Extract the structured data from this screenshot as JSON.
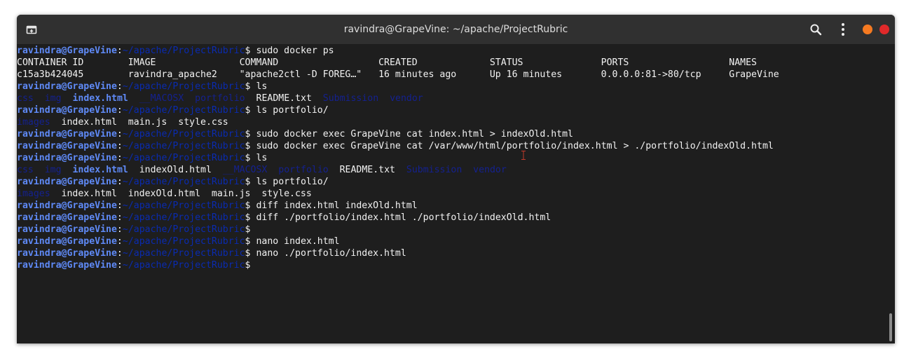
{
  "window": {
    "title": "ravindra@GrapeVine: ~/apache/ProjectRubric"
  },
  "icons": {
    "new_tab": "new-tab-icon",
    "search": "search-icon",
    "menu": "kebab-menu-icon",
    "minimize": "minimize-icon",
    "close": "close-icon"
  },
  "colors": {
    "background": "#1e1e1e",
    "titlebar": "#303030",
    "prompt_user": "#5f8af7",
    "prompt_path": "#0a2bb0",
    "directory": "#14218f",
    "text": "#f2f2f2",
    "minimize": "#f57a21",
    "close": "#e0292a"
  },
  "prompt": {
    "user": "ravindra@GrapeVine",
    "sep": ":",
    "path": "~/apache/ProjectRubric",
    "dollar": "$"
  },
  "lines": [
    {
      "type": "prompt",
      "cmd": " sudo docker ps"
    },
    {
      "type": "output",
      "segments": [
        {
          "k": "f",
          "t": "CONTAINER ID        IMAGE               COMMAND                  CREATED             STATUS              PORTS                  NAMES"
        }
      ]
    },
    {
      "type": "output",
      "segments": [
        {
          "k": "f",
          "t": "c15a3b424045        ravindra_apache2    \"apache2ctl -D FOREG…\"   16 minutes ago      Up 16 minutes       0.0.0.0:81->80/tcp     GrapeVine"
        }
      ]
    },
    {
      "type": "prompt",
      "cmd": " ls"
    },
    {
      "type": "output",
      "segments": [
        {
          "k": "d",
          "t": "css"
        },
        {
          "k": "f",
          "t": "  "
        },
        {
          "k": "d",
          "t": "img"
        },
        {
          "k": "f",
          "t": "  "
        },
        {
          "k": "u",
          "t": "index.html"
        },
        {
          "k": "f",
          "t": "  "
        },
        {
          "k": "d",
          "t": "__MACOSX"
        },
        {
          "k": "f",
          "t": "  "
        },
        {
          "k": "d",
          "t": "portfolio"
        },
        {
          "k": "f",
          "t": "  README.txt  "
        },
        {
          "k": "d",
          "t": "Submission"
        },
        {
          "k": "f",
          "t": "  "
        },
        {
          "k": "d",
          "t": "vendor"
        }
      ]
    },
    {
      "type": "prompt",
      "cmd": " ls portfolio/"
    },
    {
      "type": "output",
      "segments": [
        {
          "k": "d",
          "t": "images"
        },
        {
          "k": "f",
          "t": "  index.html  main.js  style.css"
        }
      ]
    },
    {
      "type": "prompt",
      "cmd": " sudo docker exec GrapeVine cat index.html > indexOld.html"
    },
    {
      "type": "prompt",
      "cmd": " sudo docker exec GrapeVine cat /var/www/html/portfolio/index.html > ./portfolio/indexOld.html"
    },
    {
      "type": "prompt",
      "cmd": " ls"
    },
    {
      "type": "output",
      "segments": [
        {
          "k": "d",
          "t": "css"
        },
        {
          "k": "f",
          "t": "  "
        },
        {
          "k": "d",
          "t": "img"
        },
        {
          "k": "f",
          "t": "  "
        },
        {
          "k": "u",
          "t": "index.html"
        },
        {
          "k": "f",
          "t": "  indexOld.html  "
        },
        {
          "k": "d",
          "t": "__MACOSX"
        },
        {
          "k": "f",
          "t": "  "
        },
        {
          "k": "d",
          "t": "portfolio"
        },
        {
          "k": "f",
          "t": "  README.txt  "
        },
        {
          "k": "d",
          "t": "Submission"
        },
        {
          "k": "f",
          "t": "  "
        },
        {
          "k": "d",
          "t": "vendor"
        }
      ]
    },
    {
      "type": "prompt",
      "cmd": " ls portfolio/"
    },
    {
      "type": "output",
      "segments": [
        {
          "k": "d",
          "t": "images"
        },
        {
          "k": "f",
          "t": "  index.html  indexOld.html  main.js  style.css"
        }
      ]
    },
    {
      "type": "prompt",
      "cmd": " diff index.html indexOld.html"
    },
    {
      "type": "prompt",
      "cmd": " diff ./portfolio/index.html ./portfolio/indexOld.html"
    },
    {
      "type": "prompt",
      "cmd": ""
    },
    {
      "type": "prompt",
      "cmd": " nano index.html"
    },
    {
      "type": "prompt",
      "cmd": " nano ./portfolio/index.html"
    },
    {
      "type": "prompt",
      "cmd": ""
    }
  ]
}
